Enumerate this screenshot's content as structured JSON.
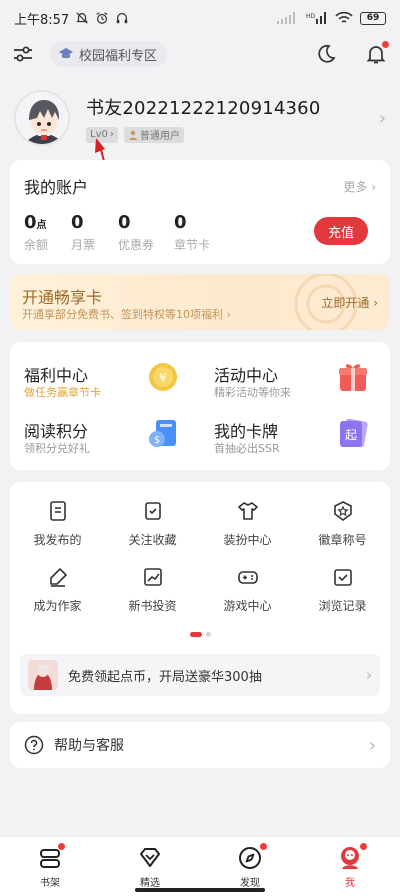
{
  "status_bar": {
    "time": "上午8:57",
    "battery": "69",
    "network": "5G HD"
  },
  "top_bar": {
    "campus_label": "校园福利专区"
  },
  "profile": {
    "name": "书友20221222120914360",
    "level": "Lv0",
    "user_type": "普通用户"
  },
  "account": {
    "title": "我的账户",
    "more": "更多",
    "recharge": "充值",
    "stats": [
      {
        "value": "0",
        "unit": "点",
        "label": "余额"
      },
      {
        "value": "0",
        "label": "月票"
      },
      {
        "value": "0",
        "label": "优惠券"
      },
      {
        "value": "0",
        "label": "章节卡"
      }
    ]
  },
  "vip": {
    "title": "开通畅享卡",
    "subtitle": "开通享部分免费书、签到特权等10项福利",
    "action": "立即开通"
  },
  "centers": [
    {
      "title": "福利中心",
      "subtitle": "做任务赢章节卡"
    },
    {
      "title": "活动中心",
      "subtitle": "精彩活动等你来"
    },
    {
      "title": "阅读积分",
      "subtitle": "领积分兑好礼"
    },
    {
      "title": "我的卡牌",
      "subtitle": "首抽必出SSR"
    }
  ],
  "grid_items": [
    {
      "label": "我发布的",
      "icon": "document-icon"
    },
    {
      "label": "关注收藏",
      "icon": "bookmark-check-icon"
    },
    {
      "label": "装扮中心",
      "icon": "tshirt-icon"
    },
    {
      "label": "徽章称号",
      "icon": "badge-star-icon"
    },
    {
      "label": "成为作家",
      "icon": "pen-icon"
    },
    {
      "label": "新书投资",
      "icon": "trend-chart-icon"
    },
    {
      "label": "游戏中心",
      "icon": "gamepad-icon"
    },
    {
      "label": "浏览记录",
      "icon": "history-icon"
    }
  ],
  "promo": {
    "text": "免费领起点币，开局送豪华300抽"
  },
  "help": {
    "label": "帮助与客服"
  },
  "tabs": [
    {
      "label": "书架",
      "icon": "bookshelf-icon"
    },
    {
      "label": "精选",
      "icon": "diamond-icon"
    },
    {
      "label": "发现",
      "icon": "compass-icon"
    },
    {
      "label": "我",
      "icon": "me-icon"
    }
  ],
  "colors": {
    "accent": "#e2393f",
    "gold": "#e4a533",
    "vip_text": "#9b6a26"
  }
}
